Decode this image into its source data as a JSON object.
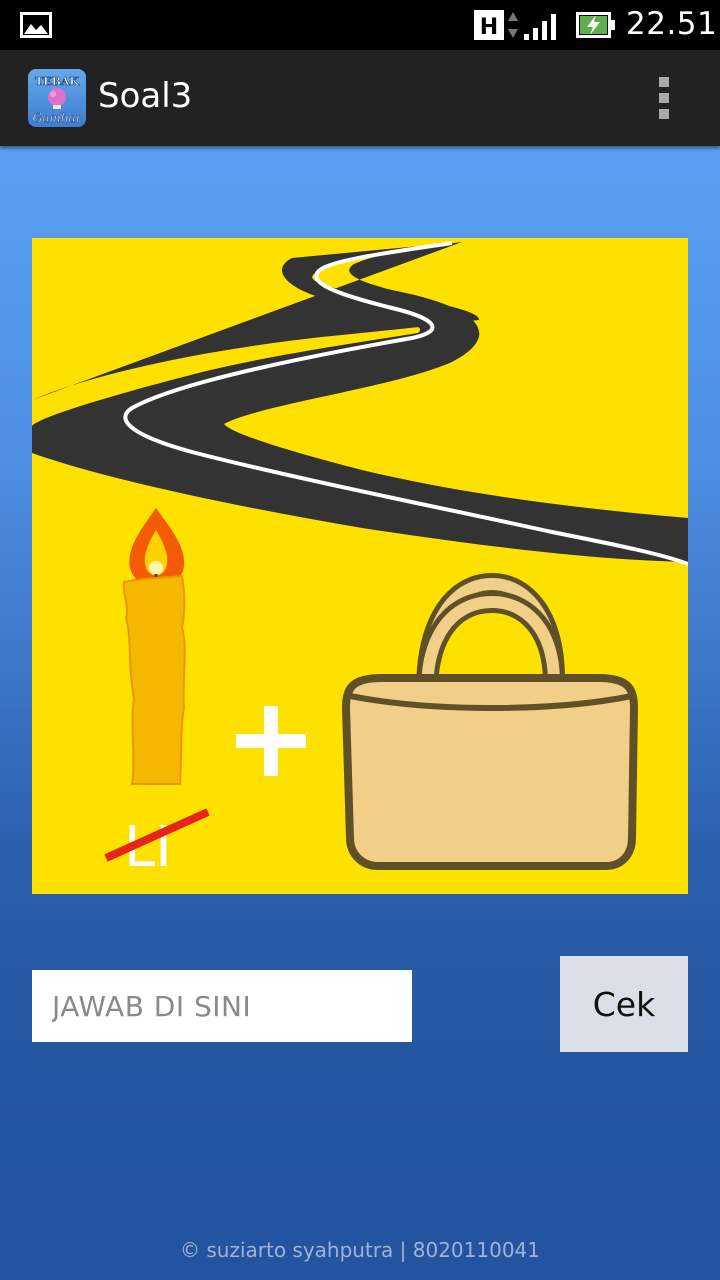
{
  "status_bar": {
    "time": "22.51",
    "network_type": "H",
    "icons": [
      "gallery-icon",
      "h-network-icon",
      "data-arrows-icon",
      "signal-icon",
      "battery-charging-icon"
    ]
  },
  "action_bar": {
    "app_icon": "tebak-gambar-icon",
    "app_icon_text_top": "TEBAK",
    "app_icon_text_bottom": "Gambar",
    "title": "Soal3",
    "overflow_icon": "overflow-menu-icon"
  },
  "puzzle": {
    "elements": [
      "road-image",
      "candle-image",
      "plus-sign",
      "bag-image"
    ],
    "removed_letters": "LI",
    "colors": {
      "background": "#ffe100",
      "road": "#333333",
      "road_line": "#ffffff",
      "candle": "#f5b800",
      "strike": "#e8231a",
      "bag": "#f1cf88",
      "bag_outline": "#5f5028"
    }
  },
  "answer": {
    "placeholder": "JAWAB DI SINI",
    "value": ""
  },
  "check_button": {
    "label": "Cek"
  },
  "footer": {
    "text": "© suziarto syahputra  |  8020110041"
  },
  "colors": {
    "status_bar": "#000000",
    "action_bar": "#222222",
    "bg_top": "#5b9ff3",
    "bg_bottom": "#2453a0",
    "button_bg": "#dcdfe8"
  }
}
